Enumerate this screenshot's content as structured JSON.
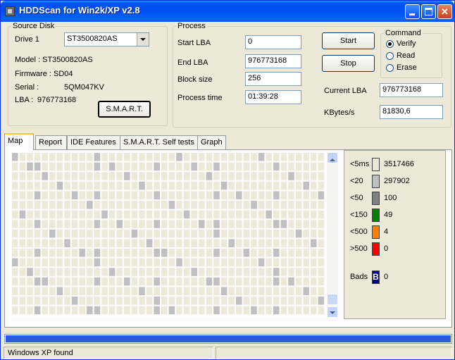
{
  "window": {
    "title": "HDDScan for Win2k/XP  v2.8"
  },
  "source_disk": {
    "legend": "Source Disk",
    "drive_label": "Drive  1",
    "drive_value": "ST3500820AS",
    "model": "Model : ST3500820AS",
    "firmware": "Firmware : SD04",
    "serial_label": "Serial :",
    "serial_value": "5QM047KV",
    "lba_label": "LBA :",
    "lba_value": "976773168",
    "smart_button": "S.M.A.R.T."
  },
  "process": {
    "legend": "Process",
    "start_lba_label": "Start LBA",
    "start_lba": "0",
    "end_lba_label": "End LBA",
    "end_lba": "976773168",
    "block_size_label": "Block size",
    "block_size": "256",
    "process_time_label": "Process time",
    "process_time": "01:39:28",
    "start_button": "Start",
    "stop_button": "Stop",
    "current_lba_label": "Current LBA",
    "current_lba": "976773168",
    "kbytes_label": "KBytes/s",
    "kbytes": "81830,6"
  },
  "command": {
    "legend": "Command",
    "options": [
      "Verify",
      "Read",
      "Erase"
    ],
    "selected": "Verify"
  },
  "tabs": [
    "Map",
    "Report",
    "IDE Features",
    "S.M.A.R.T. Self tests",
    "Graph"
  ],
  "active_tab": "Map",
  "map_legend": [
    {
      "label": "<5ms",
      "count": "3517466",
      "color": "#ece9d8"
    },
    {
      "label": "<20",
      "count": "297902",
      "color": "#c0c0c0"
    },
    {
      "label": "<50",
      "count": "100",
      "color": "#808080"
    },
    {
      "label": "<150",
      "count": "49",
      "color": "#008000"
    },
    {
      "label": "<500",
      "count": "4",
      "color": "#ff8000"
    },
    {
      "label": ">500",
      "count": "0",
      "color": "#ff0000"
    }
  ],
  "bads": {
    "label": "Bads",
    "glyph": "B",
    "count": "0"
  },
  "progress": 1.0,
  "status": {
    "text": "Windows XP found"
  }
}
